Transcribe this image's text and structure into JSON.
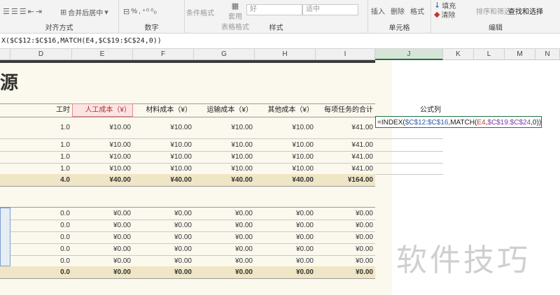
{
  "ribbon": {
    "merge_center": "合并后居中",
    "percent": "%",
    "comma": ",",
    "conditional_format": "条件格式",
    "table_format_1": "套用",
    "table_format_2": "表格格式",
    "style_good": "好",
    "style_neutral": "适中",
    "insert": "插入",
    "delete": "删除",
    "format": "格式",
    "fill": "填充",
    "clear": "清除",
    "sort_filter": "排序和筛选",
    "find_select": "查找和选择",
    "groups": {
      "alignment": "对齐方式",
      "number": "数字",
      "styles": "样式",
      "cells": "单元格",
      "editing": "编辑"
    }
  },
  "formula_bar": {
    "text": "X($C$12:$C$16,MATCH(E4,$C$19:$C$24,0))"
  },
  "columns": [
    "D",
    "E",
    "F",
    "G",
    "H",
    "I",
    "J",
    "K",
    "L",
    "M",
    "N"
  ],
  "sheet": {
    "title_glyph": "源",
    "headers": [
      "工时",
      "人工成本（¥）",
      "材料成本（¥）",
      "运输成本（¥）",
      "其他成本（¥）",
      "每项任务的合计",
      "公式列"
    ],
    "table1_rows": [
      [
        "1.0",
        "¥10.00",
        "¥10.00",
        "¥10.00",
        "¥10.00",
        "¥41.00"
      ],
      [
        "1.0",
        "¥10.00",
        "¥10.00",
        "¥10.00",
        "¥10.00",
        "¥41.00"
      ],
      [
        "1.0",
        "¥10.00",
        "¥10.00",
        "¥10.00",
        "¥10.00",
        "¥41.00"
      ],
      [
        "1.0",
        "¥10.00",
        "¥10.00",
        "¥10.00",
        "¥10.00",
        "¥41.00"
      ]
    ],
    "table1_total": [
      "4.0",
      "¥40.00",
      "¥40.00",
      "¥40.00",
      "¥40.00",
      "¥164.00"
    ],
    "formula_cell": {
      "p1": "=INDEX(",
      "p2": "$C$12:$C$16",
      "p3": ",MATCH(",
      "p4": "E4",
      "p5": ",",
      "p6": "$C$19:$C$24",
      "p7": ",0))"
    },
    "table2_rows": [
      [
        "0.0",
        "¥0.00",
        "¥0.00",
        "¥0.00",
        "¥0.00",
        "¥0.00"
      ],
      [
        "0.0",
        "¥0.00",
        "¥0.00",
        "¥0.00",
        "¥0.00",
        "¥0.00"
      ],
      [
        "0.0",
        "¥0.00",
        "¥0.00",
        "¥0.00",
        "¥0.00",
        "¥0.00"
      ],
      [
        "0.0",
        "¥0.00",
        "¥0.00",
        "¥0.00",
        "¥0.00",
        "¥0.00"
      ],
      [
        "0.0",
        "¥0.00",
        "¥0.00",
        "¥0.00",
        "¥0.00",
        "¥0.00"
      ]
    ],
    "table2_total": [
      "0.0",
      "¥0.00",
      "¥0.00",
      "¥0.00",
      "¥0.00",
      "¥0.00"
    ]
  },
  "watermark": "软件技巧",
  "colors": {
    "excel_green": "#217346",
    "cream": "#fbf8ee",
    "total_band": "#efe6c6",
    "header_pink": "#fde4e4"
  }
}
